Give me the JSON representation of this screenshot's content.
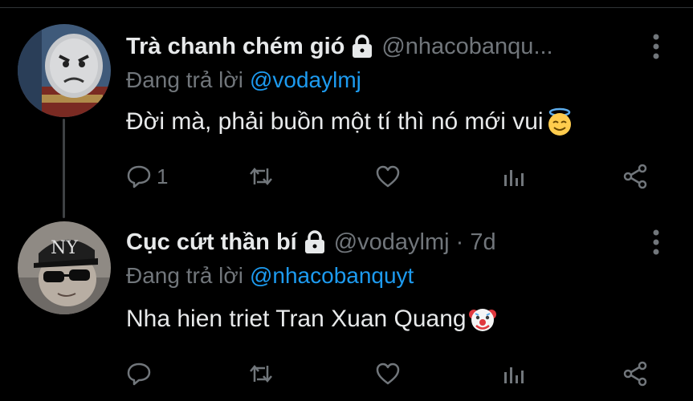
{
  "tweets": [
    {
      "display_name": "Trà chanh chém gió",
      "handle": "@nhacobanqu...",
      "reply_prefix": "Đang trả lời",
      "reply_to": "@vodaylmj",
      "text": "Đời mà, phải buồn một tí thì nó mới vui",
      "emoji": "smiling-face-with-halo",
      "reply_count": "1",
      "avatar": "cartoon-train-face"
    },
    {
      "display_name": "Cục cứt thần bí",
      "handle": "@vodaylmj · 7d",
      "reply_prefix": "Đang trả lời",
      "reply_to": "@nhacobanquyt",
      "text": "Nha hien triet Tran Xuan Quang",
      "emoji": "clown-face",
      "reply_count": "",
      "avatar": "cat-with-cap-and-sunglasses"
    }
  ],
  "colors": {
    "background": "#000000",
    "text": "#e7e9ea",
    "muted": "#71767b",
    "link": "#1d9bf0",
    "divider": "#2f3336"
  }
}
